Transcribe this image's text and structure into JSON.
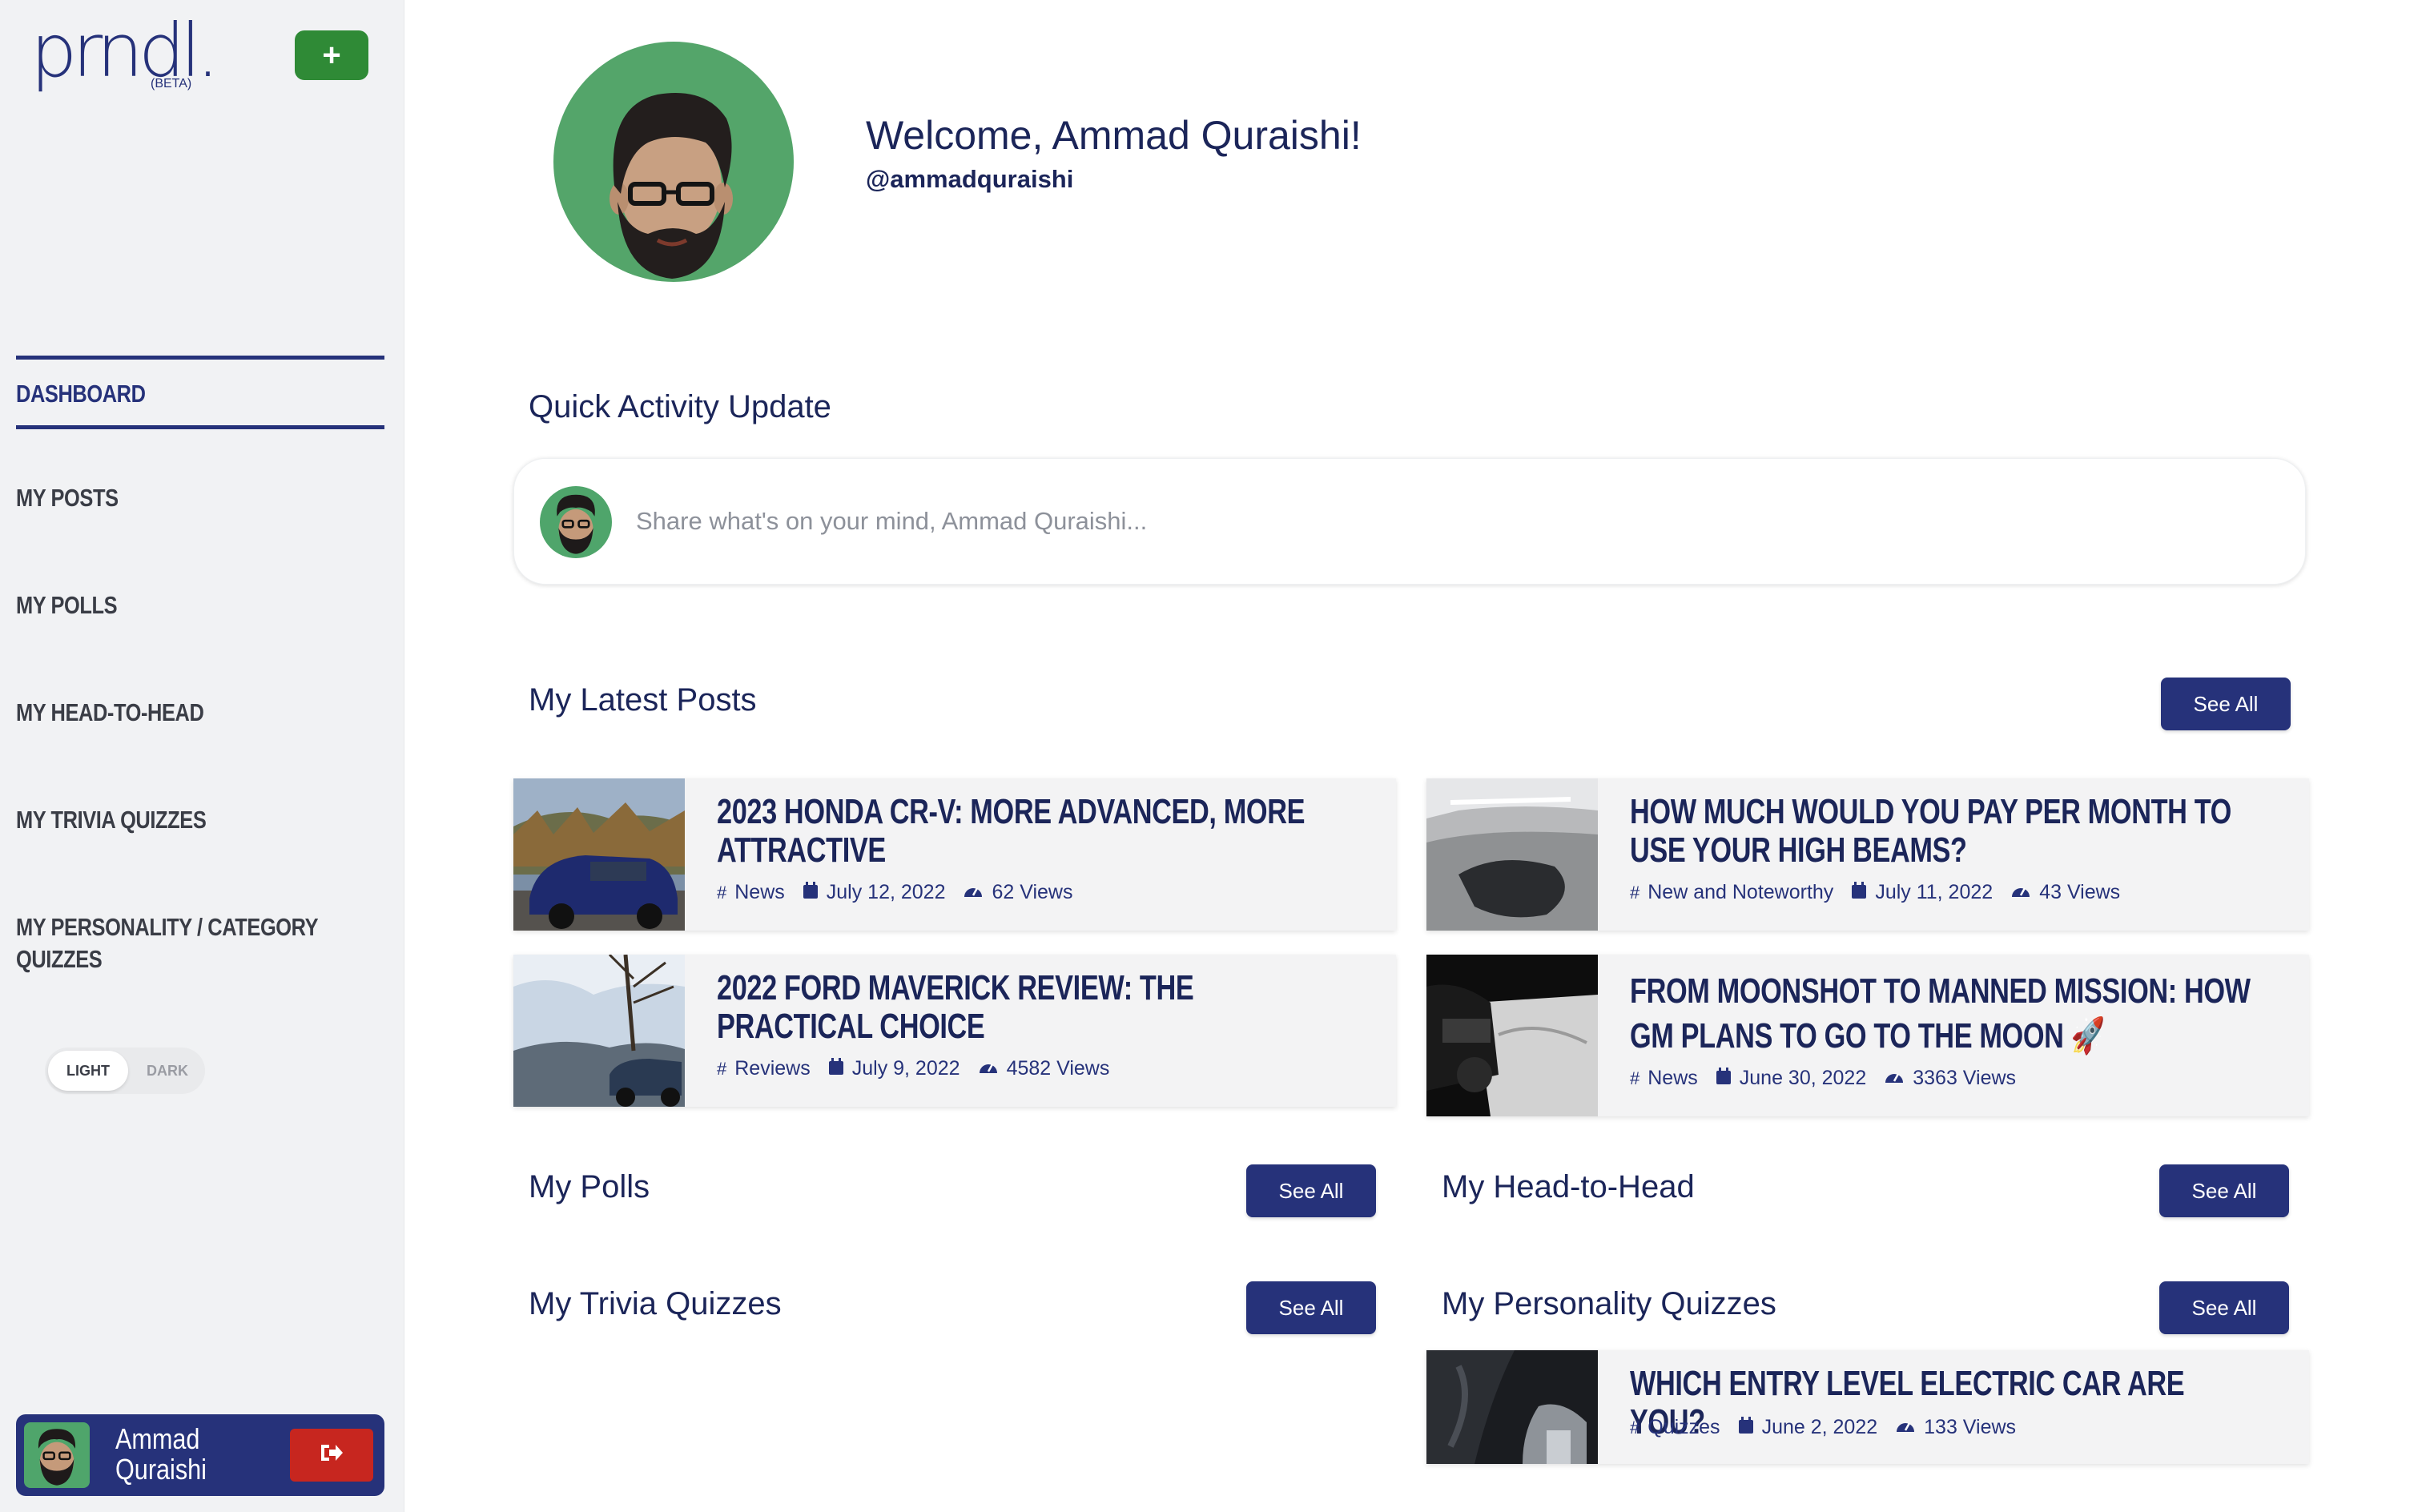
{
  "sidebar": {
    "logo_text": "prndl.",
    "logo_badge": "(BETA)",
    "add_label": "+",
    "nav": [
      {
        "label": "DASHBOARD",
        "active": true
      },
      {
        "label": "MY POSTS"
      },
      {
        "label": "MY POLLS"
      },
      {
        "label": "MY HEAD-TO-HEAD"
      },
      {
        "label": "MY TRIVIA QUIZZES"
      },
      {
        "label": "MY PERSONALITY / CATEGORY"
      },
      {
        "label": "QUIZZES"
      }
    ],
    "theme": {
      "light": "LIGHT",
      "dark": "DARK"
    },
    "user": {
      "first": "Ammad",
      "last": "Quraishi",
      "logout_icon": "sign-out-icon"
    }
  },
  "profile": {
    "welcome": "Welcome, Ammad Quraishi!",
    "handle": "@ammadquraishi"
  },
  "quick_activity": {
    "title": "Quick Activity Update",
    "placeholder": "Share what's on your mind, Ammad Quraishi..."
  },
  "latest_posts": {
    "title": "My Latest Posts",
    "see_all": "See All",
    "posts": [
      {
        "title": "2023 Honda CR-V: More Advanced, More Attractive",
        "category": "News",
        "date": "July 12, 2022",
        "views": "62 Views"
      },
      {
        "title": "How Much Would You Pay Per Month To Use Your High Beams?",
        "category": "New and Noteworthy",
        "date": "July 11, 2022",
        "views": "43 Views"
      },
      {
        "title": "2022 Ford Maverick Review: The Practical Choice",
        "category": "Reviews",
        "date": "July 9, 2022",
        "views": "4582 Views"
      },
      {
        "title": "From Moonshot To Manned Mission: How GM Plans To Go To The Moon 🚀",
        "category": "News",
        "date": "June 30, 2022",
        "views": "3363 Views"
      }
    ]
  },
  "polls": {
    "title": "My Polls",
    "see_all": "See All"
  },
  "head_to_head": {
    "title": "My Head-to-Head",
    "see_all": "See All"
  },
  "trivia": {
    "title": "My Trivia Quizzes",
    "see_all": "See All"
  },
  "personality": {
    "title": "My Personality Quizzes",
    "see_all": "See All",
    "post": {
      "title": "Which Entry Level Electric Car Are You?",
      "category": "Quizzes",
      "date": "June 2, 2022",
      "views": "133 Views"
    }
  },
  "colors": {
    "brand": "#26327a",
    "add_green": "#2f8a36",
    "logout_red": "#c7261f",
    "avatar_green": "#54a56a"
  }
}
